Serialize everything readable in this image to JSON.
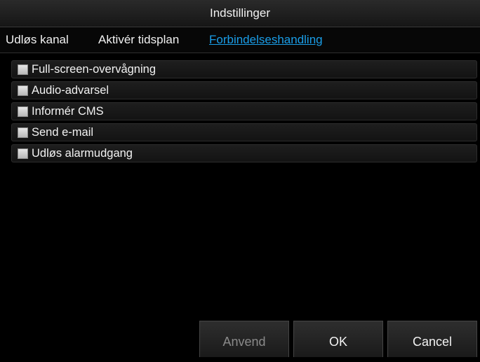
{
  "window": {
    "title": "Indstillinger"
  },
  "tabs": [
    {
      "label": "Udløs kanal",
      "active": false
    },
    {
      "label": "Aktivér tidsplan",
      "active": false
    },
    {
      "label": "Forbindelseshandling",
      "active": true
    }
  ],
  "options": [
    {
      "label": "Full-screen-overvågning",
      "checked": false
    },
    {
      "label": "Audio-advarsel",
      "checked": false
    },
    {
      "label": "Informér CMS",
      "checked": false
    },
    {
      "label": "Send e-mail",
      "checked": false
    },
    {
      "label": "Udløs alarmudgang",
      "checked": false
    }
  ],
  "buttons": {
    "apply": "Anvend",
    "ok": "OK",
    "cancel": "Cancel"
  },
  "colors": {
    "accent": "#1a9ee8",
    "background": "#000000"
  }
}
